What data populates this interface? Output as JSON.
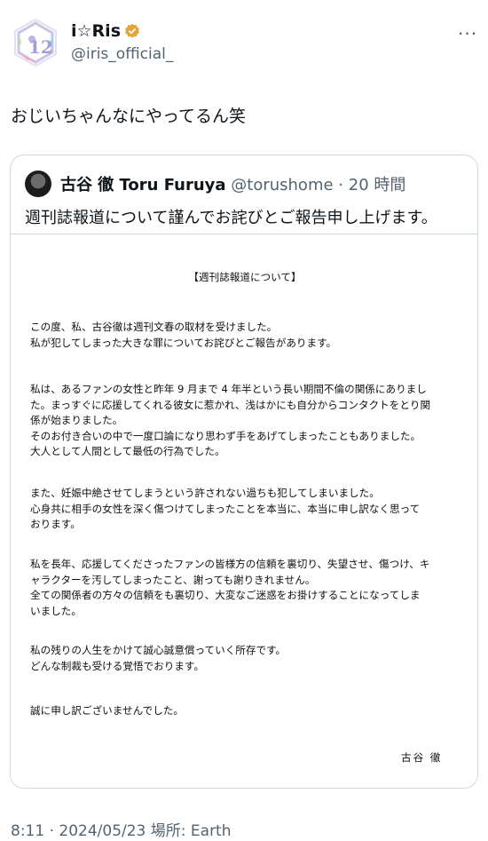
{
  "author": {
    "display_name": "i☆Ris",
    "handle": "@iris_official_",
    "verified_badge_color": "#e1a53b",
    "avatar_icon": "iris-logo-icon"
  },
  "tweet": {
    "text": "おじいちゃんなにやってるん笑",
    "timestamp": "8:11 · 2024/05/23 場所: Earth"
  },
  "quote": {
    "display_name": "古谷 徹 Toru Furuya",
    "handle": "@torushome",
    "time": "· 20 時間",
    "text": "週刊誌報道について謹んでお詫びとご報告申し上げます。",
    "document": {
      "title": "【週刊誌報道について】",
      "paragraphs": [
        [
          "この度、私、古谷徹は週刊文春の取材を受けました。",
          "私が犯してしまった大きな罪についてお詫びとご報告があります。"
        ],
        [
          "私は、あるファンの女性と昨年 9 月まで 4 年半という長い期間不倫の関係にありまし",
          "た。まっすぐに応援してくれる彼女に惹かれ、浅はかにも自分からコンタクトをとり関",
          "係が始まりました。",
          "そのお付き合いの中で一度口論になり思わず手をあげてしまったこともありました。",
          "大人として人間として最低の行為でした。"
        ],
        [
          "また、妊娠中絶させてしまうという許されない過ちも犯してしまいました。",
          "心身共に相手の女性を深く傷つけてしまったことを本当に、本当に申し訳なく思って",
          "おります。"
        ],
        [
          "私を長年、応援してくださったファンの皆様方の信頼を裏切り、失望させ、傷つけ、キ",
          "ャラクターを汚してしまったこと、謝っても謝りきれません。",
          "全ての関係者の方々の信頼をも裏切り、大変なご迷惑をお掛けすることになってしま",
          "いました。"
        ],
        [
          "私の残りの人生をかけて誠心誠意償っていく所存です。",
          "どんな制裁も受ける覚悟でおります。"
        ],
        [
          "誠に申し訳ございませんでした。"
        ]
      ],
      "signature": "古谷 徹"
    }
  },
  "icons": {
    "more": "more-options-icon"
  }
}
